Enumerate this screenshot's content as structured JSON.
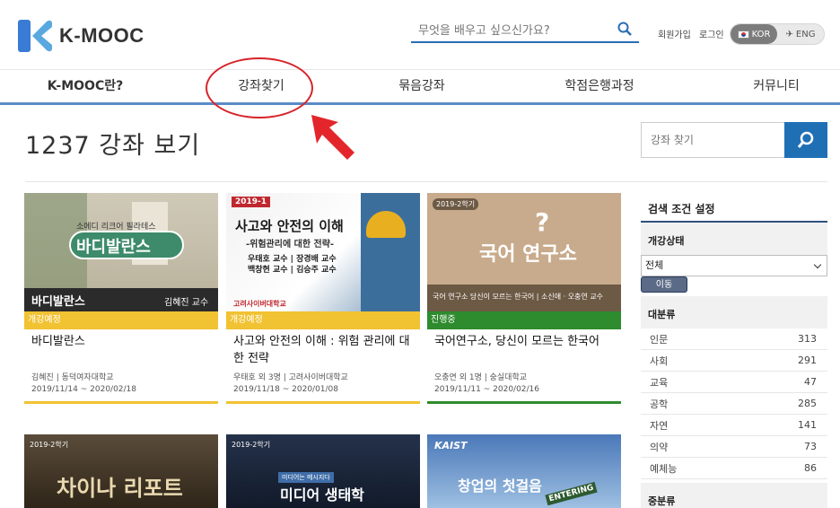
{
  "header": {
    "logo_text": "K-MOOC",
    "search_placeholder": "무엇을 배우고 싶으신가요?",
    "signup": "회원가입",
    "login": "로그인",
    "lang_kor": "KOR",
    "lang_eng": "ENG"
  },
  "nav": [
    "K-MOOC란?",
    "강좌찾기",
    "묶음강좌",
    "학점은행과정",
    "커뮤니티"
  ],
  "main": {
    "count_title": "1237 강좌 보기",
    "side_search_placeholder": "강좌 찾기"
  },
  "courses": [
    {
      "thumb_main": "바디발란스",
      "thumb_sub": "소에디 리크어 필라테스",
      "thumb_caption": "바디발란스",
      "thumb_prof": "김혜진 교수",
      "status": "개강예정",
      "status_color": "#f1c232",
      "title": "바디발란스",
      "meta": "김혜진 | 동덕여자대학교",
      "dates": "2019/11/14 ~ 2020/02/18",
      "bar_color": "#f1c232"
    },
    {
      "thumb_badge": "2019-1",
      "thumb_main": "사고와 안전의 이해",
      "thumb_sub": "-위험관리에 대한 전략-",
      "thumb_prof1": "우태호 교수 | 장경배 교수",
      "thumb_prof2": "백창현 교수 | 김승주 교수",
      "thumb_univ": "고려사이버대학교",
      "status": "개강예정",
      "status_color": "#f1c232",
      "title": "사고와 안전의 이해 : 위험 관리에 대한 전략",
      "meta": "우태호 외 3명 | 고려사이버대학교",
      "dates": "2019/11/18 ~ 2020/01/08",
      "bar_color": "#f1c232"
    },
    {
      "thumb_badge": "2019-2학기",
      "thumb_main": "국어 연구소",
      "thumb_caption": "국어 연구소 당신이 모르는 한국어 | 소신애 · 오충연 교수",
      "status": "진행중",
      "status_color": "#2e8b2e",
      "title": "국어연구소, 당신이 모르는 한국어",
      "meta": "오충연 외 1명 | 숭실대학교",
      "dates": "2019/11/11 ~ 2020/02/16",
      "bar_color": "#2e8b2e"
    },
    {
      "thumb_badge": "2019-2학기",
      "thumb_main": "차이나 리포트"
    },
    {
      "thumb_badge": "2019-2학기",
      "thumb_main": "미디어 생태학",
      "thumb_sub": "미디어는 메시지다"
    },
    {
      "thumb_badge": "KAIST",
      "thumb_main": "창업의 첫걸음",
      "thumb_sub": "ENTERING"
    }
  ],
  "filter": {
    "title": "검색 조건 설정",
    "status_label": "개강상태",
    "status_value": "전체",
    "move_button": "이동",
    "category_label": "대분류",
    "categories": [
      {
        "name": "인문",
        "count": "313"
      },
      {
        "name": "사회",
        "count": "291"
      },
      {
        "name": "교육",
        "count": "47"
      },
      {
        "name": "공학",
        "count": "285"
      },
      {
        "name": "자연",
        "count": "141"
      },
      {
        "name": "의약",
        "count": "73"
      },
      {
        "name": "예체능",
        "count": "86"
      }
    ],
    "subcategory_label": "중분류"
  },
  "colors": {
    "accent": "#1f6fb5",
    "nav_border": "#5a8ac6",
    "annotation": "#d8232a"
  }
}
